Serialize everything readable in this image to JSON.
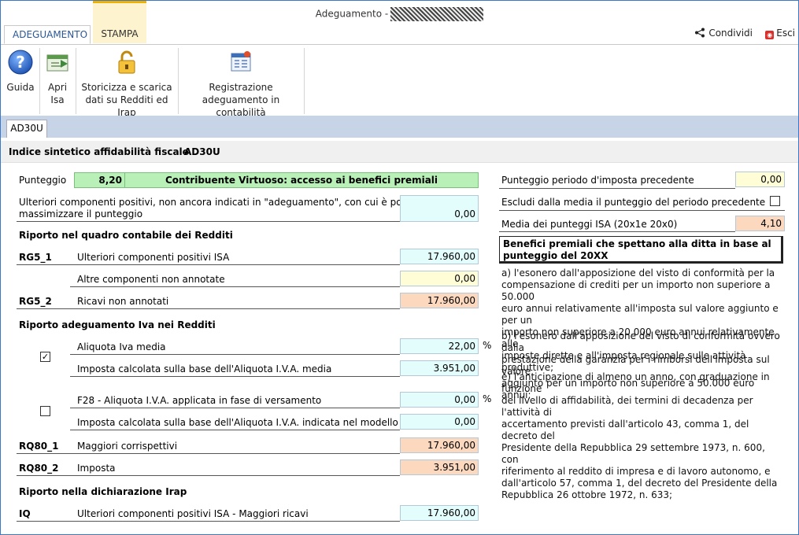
{
  "window": {
    "title": "Adeguamento -"
  },
  "ribbon_tabs": [
    "ADEGUAMENTO",
    "STAMPA"
  ],
  "actions": {
    "share": "Condividi",
    "exit": "Esci"
  },
  "ribbon": {
    "guida": "Guida",
    "apri_isa": [
      "Apri",
      "Isa"
    ],
    "storicizza": [
      "Storicizza e scarica",
      "dati su Redditi ed Irap"
    ],
    "registrazione": [
      "Registrazione",
      "adeguamento in contabilità"
    ]
  },
  "doc_tab": "AD30U",
  "header": {
    "title": "Indice sintetico affidabilità fiscale",
    "code": "AD30U"
  },
  "punteggio": {
    "label": "Punteggio",
    "value": "8,20",
    "status": "Contribuente Virtuoso: accesso ai benefici premiali"
  },
  "ulteriori": {
    "lines": [
      "Ulteriori componenti positivi, non ancora indicati in \"adeguamento\", con cui è possibile",
      "massimizzare il punteggio"
    ],
    "value": "0,00"
  },
  "redditi": {
    "title": "Riporto nel quadro contabile dei Redditi",
    "rg5_1": {
      "code": "RG5_1",
      "label": "Ulteriori componenti positivi ISA",
      "value": "17.960,00"
    },
    "altre": {
      "label": "Altre componenti non annotate",
      "value": "0,00"
    },
    "rg5_2": {
      "code": "RG5_2",
      "label": "Ricavi non annotati",
      "value": "17.960,00"
    }
  },
  "iva": {
    "title": "Riporto adeguamento Iva nei Redditi",
    "aliquota_media": {
      "label": "Aliquota Iva media",
      "value": "22,00",
      "unit": "%",
      "checked": true,
      "check_glyph": "✓"
    },
    "imposta_media": {
      "label": "Imposta calcolata sulla base dell'Aliquota I.V.A. media",
      "value": "3.951,00"
    },
    "f28": {
      "label": "F28 - Aliquota I.V.A. applicata in fase di versamento",
      "value": "0,00",
      "unit": "%",
      "checked": false
    },
    "imposta_isa": {
      "label": "Imposta calcolata sulla base dell'Aliquota I.V.A. indicata nel modello ISA",
      "value": "0,00"
    },
    "rq80_1": {
      "code": "RQ80_1",
      "label": "Maggiori corrispettivi",
      "value": "17.960,00"
    },
    "rq80_2": {
      "code": "RQ80_2",
      "label": "Imposta",
      "value": "3.951,00"
    }
  },
  "irap": {
    "title": "Riporto nella dichiarazione Irap",
    "iq": {
      "code": "IQ",
      "label": "Ulteriori componenti positivi ISA - Maggiori ricavi",
      "value": "17.960,00"
    }
  },
  "right": {
    "prev": {
      "label": "Punteggio periodo d'imposta precedente",
      "value": "0,00"
    },
    "escludi": {
      "label": "Escludi dalla media il punteggio del periodo precedente",
      "checked": false
    },
    "media": {
      "label": "Media dei punteggi ISA (20x1e 20x0)",
      "value": "4,10"
    },
    "benefici_title": "Benefici premiali che spettano alla ditta in base al punteggio del 20XX",
    "para_a": [
      "a) l'esonero dall'apposizione del visto di conformità per la",
      "compensazione di crediti per un importo non superiore a 50.000",
      "euro annui relativamente all'imposta sul valore aggiunto e per un",
      "importo non superiore a 20.000 euro annui relativamente alle",
      "imposte dirette e all'imposta regionale sulle attività produttive;"
    ],
    "para_b": [
      "b) l'esonero dall'apposizione del visto di conformità ovvero dalla",
      "prestazione della garanzia per i rimborsi dell'imposta sul valore",
      "aggiunto per un importo non superiore a 50.000 euro annui;"
    ],
    "para_e": [
      "e) l'anticipazione di almeno un anno, con graduazione in funzione",
      "del livello di affidabilità, dei termini di decadenza per l'attività di",
      "accertamento previsti dall'articolo 43, comma 1, del decreto del",
      "Presidente della Repubblica 29 settembre 1973, n. 600, con",
      "riferimento al reddito di impresa e di lavoro autonomo, e",
      "dall'articolo 57, comma 1, del decreto del Presidente della",
      "Repubblica 26 ottobre 1972, n. 633;"
    ]
  }
}
